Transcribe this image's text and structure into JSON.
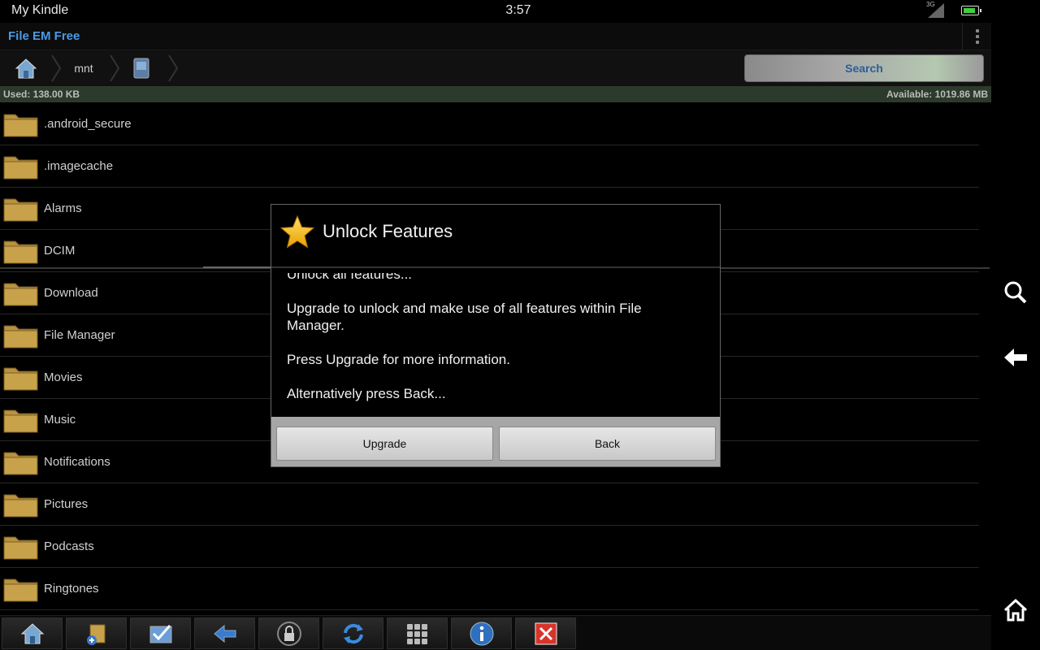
{
  "status_bar": {
    "device_name": "My Kindle",
    "time": "3:57",
    "signal_label": "3G",
    "battery_level_pct": 85
  },
  "app_bar": {
    "title": "File EM Free"
  },
  "breadcrumb": {
    "segments": [
      "mnt"
    ],
    "search_label": "Search"
  },
  "storage": {
    "used": "Used: 138.00 KB",
    "available": "Available: 1019.86 MB"
  },
  "files": [
    ".android_secure",
    ".imagecache",
    "Alarms",
    "DCIM",
    "Download",
    "File Manager",
    "Movies",
    "Music",
    "Notifications",
    "Pictures",
    "Podcasts",
    "Ringtones"
  ],
  "toolbar": {
    "items": [
      "home-icon",
      "new-folder-icon",
      "multi-select-icon",
      "back-arrow-icon",
      "lock-icon",
      "refresh-icon",
      "grid-view-icon",
      "info-icon",
      "close-icon"
    ]
  },
  "nav_rail": {
    "items": [
      "search-icon",
      "back-icon",
      "home-icon"
    ]
  },
  "dialog": {
    "title": "Unlock Features",
    "partial_line": "Unlock all features...",
    "paragraphs": [
      "Upgrade to unlock and make use of all features within File Manager.",
      "Press Upgrade for more information.",
      "Alternatively press Back..."
    ],
    "upgrade_label": "Upgrade",
    "back_label": "Back"
  },
  "colors": {
    "accent": "#4a9be8",
    "folder": "#c8a24a",
    "storage_bar": "#2c3a2c"
  }
}
